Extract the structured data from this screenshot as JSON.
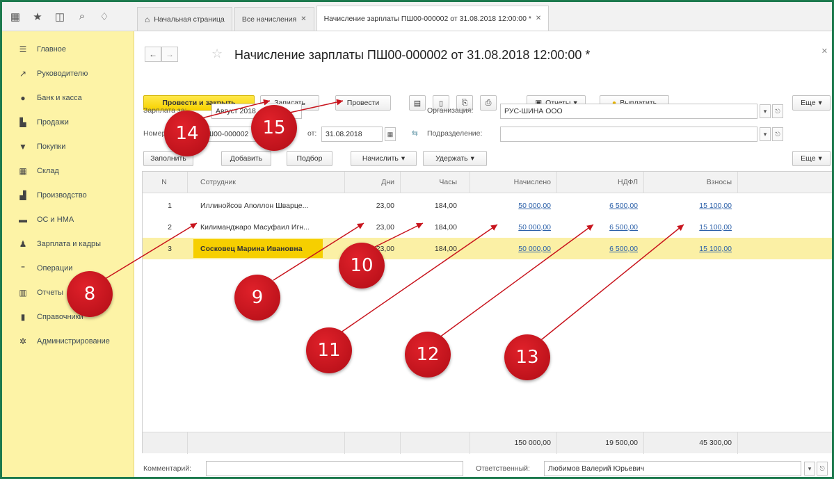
{
  "tabs": [
    {
      "label": "Начальная страница",
      "closable": false
    },
    {
      "label": "Все начисления",
      "closable": true
    },
    {
      "label": "Начисление зарплаты ПШ00-000002 от 31.08.2018 12:00:00 *",
      "closable": true
    }
  ],
  "sidebar": {
    "items": [
      {
        "icon": "list-icon",
        "label": "Главное"
      },
      {
        "icon": "chart-trend-icon",
        "label": "Руководителю"
      },
      {
        "icon": "coin-icon",
        "label": "Банк и касса"
      },
      {
        "icon": "shop-icon",
        "label": "Продажи"
      },
      {
        "icon": "cart-icon",
        "label": "Покупки"
      },
      {
        "icon": "warehouse-icon",
        "label": "Склад"
      },
      {
        "icon": "factory-icon",
        "label": "Производство"
      },
      {
        "icon": "truck-icon",
        "label": "ОС и НМА"
      },
      {
        "icon": "person-icon",
        "label": "Зарплата и кадры"
      },
      {
        "icon": "operations-icon",
        "label": "Операции"
      },
      {
        "icon": "bar-chart-icon",
        "label": "Отчеты"
      },
      {
        "icon": "book-icon",
        "label": "Справочники"
      },
      {
        "icon": "gear-icon",
        "label": "Администрирование"
      }
    ]
  },
  "document": {
    "title": "Начисление зарплаты ПШ00-000002 от 31.08.2018 12:00:00 *"
  },
  "toolbar": {
    "post_close": "Провести и закрыть",
    "save": "Записать",
    "post": "Провести",
    "reports": "Отчеты",
    "pay": "Выплатить",
    "more": "Еще"
  },
  "form": {
    "salary_label": "Зарплата за:",
    "salary_value": "Август 2018",
    "number_label": "Номер:",
    "number_value": "ПШ00-000002",
    "date_label": "от:",
    "date_value": "31.08.2018",
    "org_label": "Организация:",
    "org_value": "РУС-ШИНА ООО",
    "dept_label": "Подразделение:",
    "dept_value": ""
  },
  "table_toolbar": {
    "fill": "Заполнить",
    "add": "Добавить",
    "pick": "Подбор",
    "accrue": "Начислить",
    "withhold": "Удержать",
    "more": "Еще"
  },
  "table": {
    "columns": [
      "N",
      "Сотрудник",
      "Дни",
      "Часы",
      "Начислено",
      "НДФЛ",
      "Взносы"
    ],
    "rows": [
      {
        "n": "1",
        "employee": "Иллинойсов Аполлон Шварце...",
        "days": "23,00",
        "hours": "184,00",
        "accrued": "50 000,00",
        "ndfl": "6 500,00",
        "contrib": "15 100,00"
      },
      {
        "n": "2",
        "employee": "Килиманджаро Масуфаил Игн...",
        "days": "23,00",
        "hours": "184,00",
        "accrued": "50 000,00",
        "ndfl": "6 500,00",
        "contrib": "15 100,00"
      },
      {
        "n": "3",
        "employee": "Сосковец Марина Ивановна",
        "days": "23,00",
        "hours": "184,00",
        "accrued": "50 000,00",
        "ndfl": "6 500,00",
        "contrib": "15 100,00"
      }
    ],
    "totals": {
      "accrued": "150 000,00",
      "ndfl": "19 500,00",
      "contrib": "45 300,00"
    }
  },
  "bottom": {
    "comment_label": "Комментарий:",
    "comment_value": "",
    "responsible_label": "Ответственный:",
    "responsible_value": "Любимов Валерий Юрьевич"
  },
  "callouts": [
    "8",
    "9",
    "10",
    "11",
    "12",
    "13",
    "14",
    "15"
  ],
  "colors": {
    "sidebar_bg": "#fdf3a6",
    "primary_btn": "#f7d200",
    "badge": "#c8141d",
    "selected_row": "#fbf0a5",
    "link": "#2a5fa8",
    "frame_border": "#1d7a4e"
  }
}
